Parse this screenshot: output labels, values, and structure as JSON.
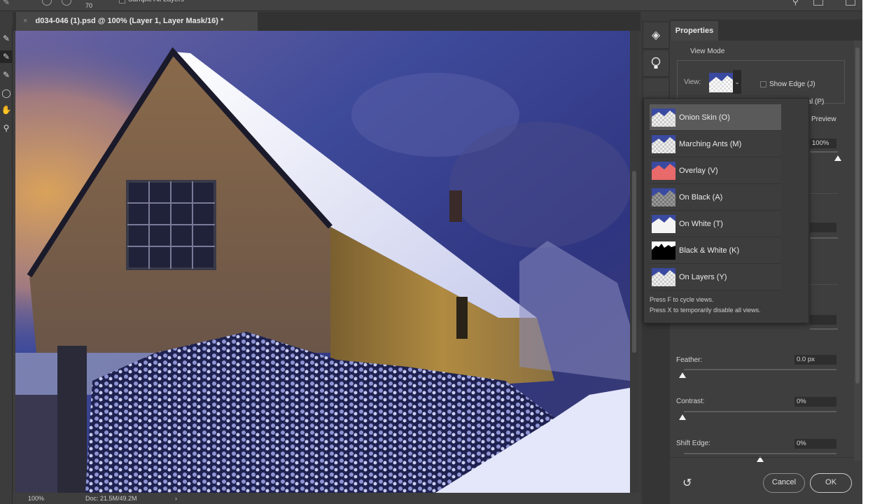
{
  "options_bar": {
    "size_value": "70",
    "sample_all_layers_label": "Sample All Layers"
  },
  "toolbar": {
    "tools": [
      {
        "name": "quick-selection-tool",
        "glyph": "✎"
      },
      {
        "name": "refine-edge-brush-tool",
        "glyph": "✎",
        "active": true
      },
      {
        "name": "brush-tool",
        "glyph": "✎"
      },
      {
        "name": "lasso-tool",
        "glyph": "◯"
      },
      {
        "name": "hand-tool",
        "glyph": "✋"
      },
      {
        "name": "zoom-tool",
        "glyph": "⚲"
      }
    ]
  },
  "document": {
    "tab_title": "d034-046 (1).psd @ 100% (Layer 1, Layer Mask/16) *",
    "close_glyph": "×"
  },
  "status_bar": {
    "zoom": "100%",
    "doc_size": "Doc: 21.5M/49.2M",
    "arrow": "›"
  },
  "dock": {
    "buttons": [
      {
        "name": "layers-icon",
        "glyph": "◈"
      },
      {
        "name": "lightbulb-icon",
        "glyph": "💡"
      }
    ]
  },
  "properties": {
    "tab_label": "Properties",
    "view_mode_label": "View Mode",
    "view_label": "View:",
    "show_edge_label": "Show Edge (J)",
    "show_edge_checked": false,
    "show_original_label": "Show Original (P)",
    "show_original_checked": false,
    "preview_label": "Preview",
    "opacity_value": "100%",
    "opacity_percent": 100,
    "feather_label": "Feather:",
    "feather_value": "0.0 px",
    "feather_percent": 0,
    "contrast_label": "Contrast:",
    "contrast_value": "0%",
    "contrast_percent": 0,
    "shift_edge_label": "Shift Edge:",
    "shift_edge_value": "0%",
    "shift_edge_percent": 50,
    "cancel_label": "Cancel",
    "ok_label": "OK"
  },
  "view_menu": {
    "items": [
      {
        "label": "Onion Skin (O)",
        "thumb": "onion",
        "selected": true
      },
      {
        "label": "Marching Ants (M)",
        "thumb": "ants"
      },
      {
        "label": "Overlay (V)",
        "thumb": "overlay"
      },
      {
        "label": "On Black (A)",
        "thumb": "black"
      },
      {
        "label": "On White (T)",
        "thumb": "white"
      },
      {
        "label": "Black & White (K)",
        "thumb": "bw"
      },
      {
        "label": "On Layers (Y)",
        "thumb": "layers"
      }
    ],
    "hint_1": "Press F to cycle views.",
    "hint_2": "Press X to temporarily disable all views."
  },
  "colors": {
    "panel_bg": "#3e3e3e",
    "app_bg": "#3c3c3c",
    "overlay_red": "#e86a6a",
    "selected_item": "#5a5a5a"
  }
}
